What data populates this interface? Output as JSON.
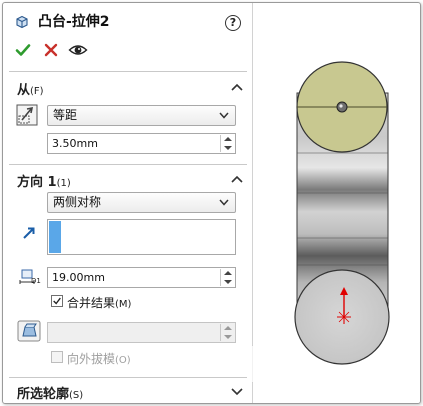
{
  "property_manager": {
    "title": "凸台-拉伸2",
    "help_label": "?",
    "actions": {
      "ok": "check-icon",
      "cancel": "x-icon",
      "preview": "eye-icon"
    }
  },
  "from_section": {
    "title": "从",
    "title_key": "(F)",
    "condition": "等距",
    "offset_value": "3.50mm"
  },
  "direction_section": {
    "title": "方向 1",
    "title_key": "(1)",
    "end_condition": "两侧对称",
    "depth_value": "19.00mm",
    "merge_result_label": "合并结果",
    "merge_result_key": "(M)",
    "merge_result_checked": true,
    "draft_value": "",
    "draft_outward_label": "向外拔模",
    "draft_outward_key": "(O)",
    "draft_outward_checked": false
  },
  "selected_contours_section": {
    "title": "所选轮廓",
    "title_key": "(S)"
  },
  "colors": {
    "ok_green": "#2e9b2e",
    "cancel_red": "#c8312b",
    "selection_blue": "#5aa7e8",
    "preview_face": "#c8c890",
    "model_gray": "#b8b8b8",
    "axis_red": "#e00000"
  }
}
